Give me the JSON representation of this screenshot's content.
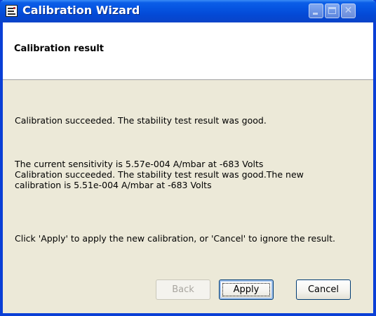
{
  "window": {
    "title": "Calibration Wizard",
    "controls": {
      "minimize": "minimize",
      "maximize": "maximize",
      "close": "✕"
    }
  },
  "header": {
    "title": "Calibration result"
  },
  "body": {
    "line1": "Calibration succeeded.  The stability test result was good.",
    "line2": "The current sensitivity is 5.57e-004 A/mbar at -683 Volts",
    "line3": "Calibration succeeded.  The stability test result was good.The new",
    "line4": "calibration is 5.51e-004 A/mbar at -683 Volts",
    "line5": "Click 'Apply' to apply the new calibration, or 'Cancel' to ignore the result."
  },
  "buttons": {
    "back": "Back",
    "apply": "Apply",
    "cancel": "Cancel"
  },
  "colors": {
    "titlebar": "#0553e0",
    "frame": "#0a3fd6",
    "dialog_bg": "#ece9d8",
    "disabled_text": "#a9a6a0"
  }
}
